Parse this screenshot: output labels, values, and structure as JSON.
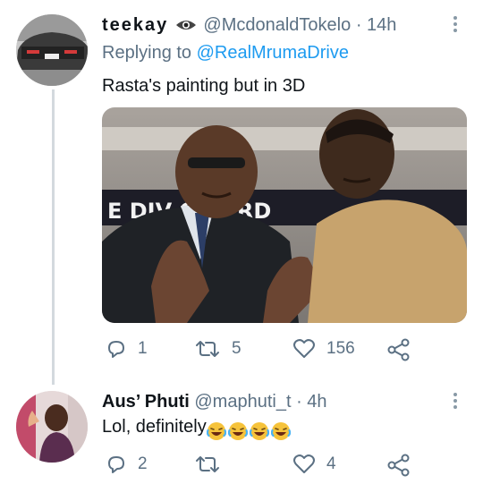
{
  "tweet1": {
    "display_name": "teekay",
    "handle": "@McdonaldTokelo",
    "time": "· 14h",
    "replying_prefix": "Replying to",
    "replying_to": "@RealMrumaDrive",
    "text": "Rasta's painting but in 3D",
    "media_banner_text": "E DIV      OWARD",
    "stats": {
      "replies": "1",
      "retweets": "5",
      "likes": "156"
    }
  },
  "tweet2": {
    "display_name": "Aus’ Phuti",
    "handle": "@maphuti_t",
    "time": "· 4h",
    "text": "Lol, definitely",
    "emoji_count": 4,
    "stats": {
      "replies": "2",
      "retweets": "",
      "likes": "4"
    }
  },
  "icons": [
    "eye-icon",
    "reply-icon",
    "retweet-icon",
    "like-icon",
    "share-icon",
    "more-icon",
    "laughing-emoji-icon"
  ],
  "colors": {
    "link": "#1d9bf0",
    "muted": "#5b7083",
    "thread_line": "#d3d9de"
  }
}
